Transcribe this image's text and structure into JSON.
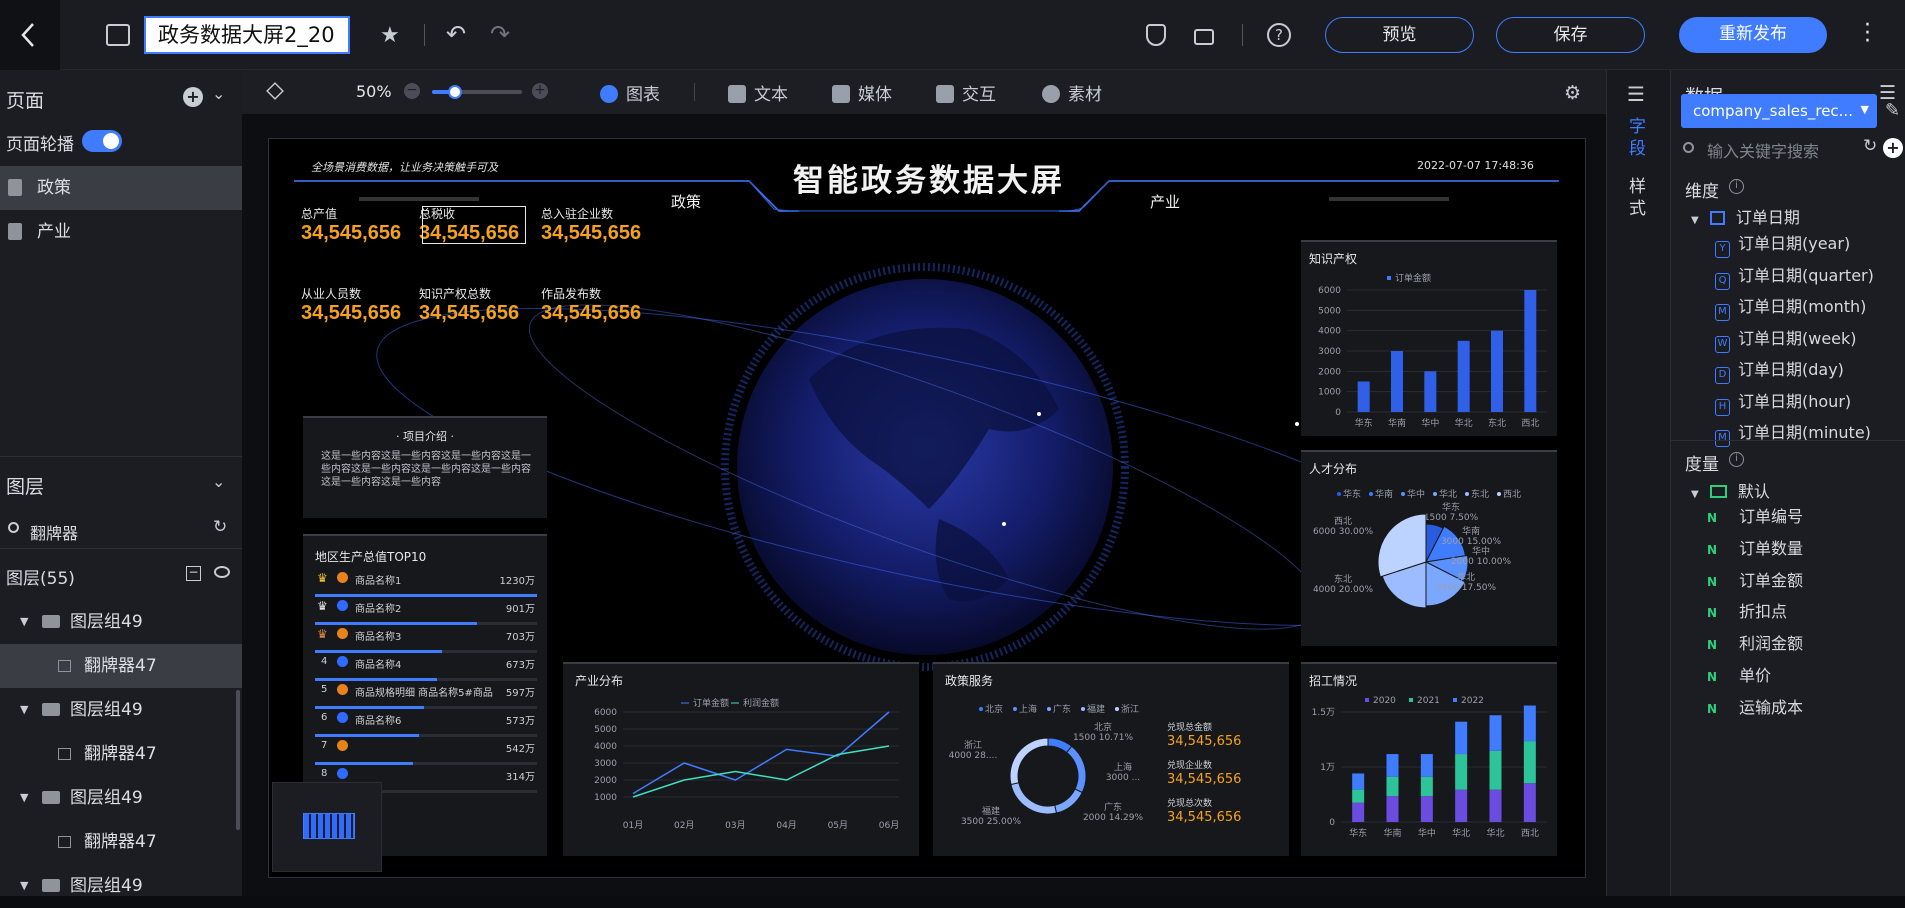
{
  "topbar": {
    "title": "政务数据大屏2_20",
    "preview": "预览",
    "save": "保存",
    "publish": "重新发布"
  },
  "toolbar": {
    "zoom": "50%",
    "zoom_level": 0.25,
    "items": [
      "图表",
      "文本",
      "媒体",
      "交互",
      "素材"
    ]
  },
  "left": {
    "pages_title": "页面",
    "carousel_label": "页面轮播",
    "carousel_on": true,
    "pages": [
      "政策",
      "产业"
    ],
    "layers_title": "图层",
    "search_value": "翻牌器",
    "layer_count": "图层(55)",
    "layers": [
      "图层组49",
      "翻牌器47",
      "图层组49",
      "翻牌器47",
      "图层组49",
      "翻牌器47",
      "图层组49"
    ]
  },
  "rstrip": {
    "fields": "字段",
    "style": "样式"
  },
  "right": {
    "title": "数据",
    "dataset": "company_sales_rec...",
    "search_placeholder": "输入关键字搜索",
    "dim_title": "维度",
    "dim_root": "订单日期",
    "dims": [
      {
        "icon": "Y",
        "label": "订单日期(year)"
      },
      {
        "icon": "Q",
        "label": "订单日期(quarter)"
      },
      {
        "icon": "M",
        "label": "订单日期(month)"
      },
      {
        "icon": "W",
        "label": "订单日期(week)"
      },
      {
        "icon": "D",
        "label": "订单日期(day)"
      },
      {
        "icon": "H",
        "label": "订单日期(hour)"
      },
      {
        "icon": "M",
        "label": "订单日期(minute)"
      }
    ],
    "measure_title": "度量",
    "measure_root": "默认",
    "measure_prefix": "N",
    "measures": [
      "订单编号",
      "订单数量",
      "订单金额",
      "折扣点",
      "利润金额",
      "单价",
      "运输成本"
    ]
  },
  "dashboard": {
    "slogan": "全场景消费数据，让业务决策触手可及",
    "title": "智能政务数据大屏",
    "datetime": "2022-07-07  17:48:36",
    "tab_left": "政策",
    "tab_right": "产业",
    "kpis": [
      {
        "label": "总产值",
        "value": "34,545,656"
      },
      {
        "label": "总税收",
        "value": "34,545,656"
      },
      {
        "label": "总入驻企业数",
        "value": "34,545,656"
      },
      {
        "label": "从业人员数",
        "value": "34,545,656"
      },
      {
        "label": "知识产权总数",
        "value": "34,545,656"
      },
      {
        "label": "作品发布数",
        "value": "34,545,656"
      }
    ],
    "intro": {
      "title": "· 项目介绍 ·",
      "text": "这是一些内容这是一些内容这是一些内容这是一些内容这是一些内容这是一些内容这是一些内容这是一些内容这是一些内容"
    },
    "top10": {
      "title": "地区生产总值TOP10",
      "rows": [
        {
          "rank": "1",
          "name": "商品名称1",
          "value": "1230万",
          "pct": 1.0
        },
        {
          "rank": "2",
          "name": "商品名称2",
          "value": "901万",
          "pct": 0.73
        },
        {
          "rank": "3",
          "name": "商品名称3",
          "value": "703万",
          "pct": 0.57
        },
        {
          "rank": "4",
          "name": "商品名称4",
          "value": "673万",
          "pct": 0.55
        },
        {
          "rank": "5",
          "name": "商品规格明细    商品名称5#商品",
          "value": "597万",
          "pct": 0.49
        },
        {
          "rank": "6",
          "name": "商品名称6",
          "value": "573万",
          "pct": 0.47
        },
        {
          "rank": "7",
          "name": "",
          "value": "542万",
          "pct": 0.44
        },
        {
          "rank": "8",
          "name": "",
          "value": "314万",
          "pct": 0.26
        }
      ]
    }
  },
  "chart_data": [
    {
      "type": "bar",
      "title": "知识产权",
      "series": [
        {
          "name": "订单金额",
          "values": [
            1500,
            3000,
            2000,
            3500,
            4000,
            6000
          ]
        }
      ],
      "categories": [
        "华东",
        "华南",
        "华中",
        "华北",
        "东北",
        "西北"
      ],
      "ylim": [
        0,
        6000
      ],
      "yticks": [
        "0",
        "1000",
        "2000",
        "3000",
        "4000",
        "5000",
        "6000"
      ]
    },
    {
      "type": "pie",
      "title": "人才分布",
      "legend": [
        "华东",
        "华南",
        "华中",
        "华北",
        "东北",
        "西北"
      ],
      "slices": [
        {
          "name": "华东",
          "value": 1500,
          "label": "1500 7.50%"
        },
        {
          "name": "华南",
          "value": 3000,
          "label": "3000 15.00%"
        },
        {
          "name": "华中",
          "value": 2000,
          "label": "2000 10.00%"
        },
        {
          "name": "华北",
          "value": 3500,
          "label": "3500 17.50%"
        },
        {
          "name": "东北",
          "value": 4000,
          "label": "4000 20.00%"
        },
        {
          "name": "西北",
          "value": 6000,
          "label": "6000 30.00%"
        }
      ]
    },
    {
      "type": "line",
      "title": "产业分布",
      "categories": [
        "01月",
        "02月",
        "03月",
        "04月",
        "05月",
        "06月"
      ],
      "series": [
        {
          "name": "订单金额",
          "values": [
            1200,
            3000,
            2000,
            3800,
            3400,
            6000
          ]
        },
        {
          "name": "利润金额",
          "values": [
            1000,
            2000,
            2500,
            2000,
            3500,
            4000
          ]
        }
      ],
      "ylim": [
        0,
        6000
      ],
      "yticks": [
        "1000",
        "2000",
        "3000",
        "4000",
        "5000",
        "6000"
      ]
    },
    {
      "type": "pie",
      "title": "政策服务",
      "legend": [
        "北京",
        "上海",
        "广东",
        "福建",
        "浙江"
      ],
      "slices": [
        {
          "name": "北京",
          "value": 1500,
          "label": "1500 10.71%"
        },
        {
          "name": "上海",
          "value": 3000,
          "label": "3000 ..."
        },
        {
          "name": "广东",
          "value": 2000,
          "label": "2000 14.29%"
        },
        {
          "name": "福建",
          "value": 3500,
          "label": "3500 25.00%"
        },
        {
          "name": "浙江",
          "value": 4000,
          "label": "4000 28...."
        }
      ],
      "stats": [
        {
          "label": "兑现总金额",
          "value": "34,545,656"
        },
        {
          "label": "兑现企业数",
          "value": "34,545,656"
        },
        {
          "label": "兑现总次数",
          "value": "34,545,656"
        }
      ]
    },
    {
      "type": "bar",
      "title": "招工情况",
      "categories": [
        "华东",
        "华南",
        "华中",
        "华北",
        "华北",
        "西北"
      ],
      "series": [
        {
          "name": "2020",
          "values": [
            0.3,
            0.4,
            0.4,
            0.5,
            0.5,
            0.6
          ]
        },
        {
          "name": "2021",
          "values": [
            0.2,
            0.3,
            0.3,
            0.55,
            0.6,
            0.65
          ]
        },
        {
          "name": "2022",
          "values": [
            0.25,
            0.35,
            0.35,
            0.5,
            0.55,
            0.55
          ]
        }
      ],
      "yticks": [
        "0",
        "1万",
        "1.5万"
      ]
    }
  ],
  "colors": {
    "accent": "#3f7cff",
    "kpi": "#f4a21d",
    "bg": "#0b0c10"
  }
}
